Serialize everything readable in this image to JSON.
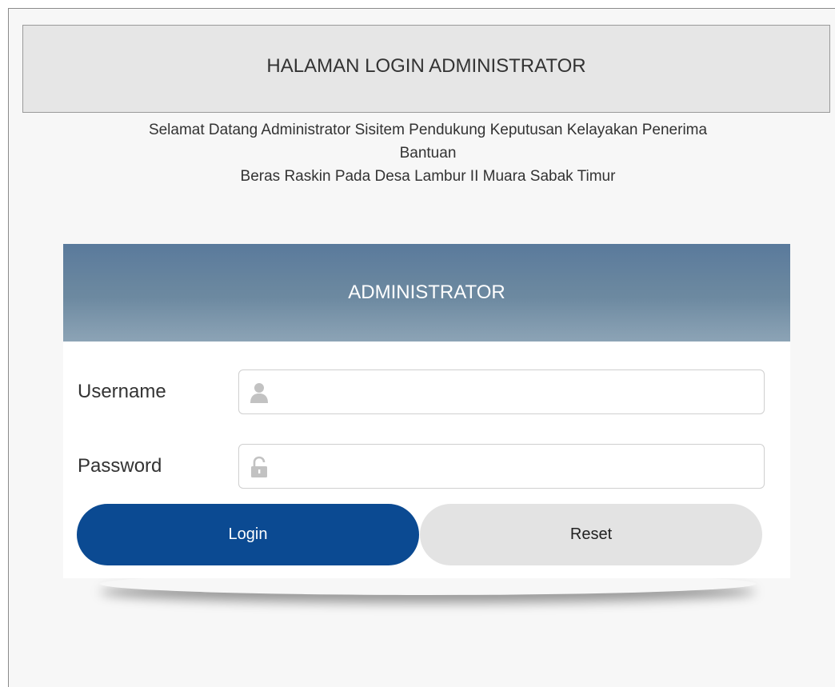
{
  "header": {
    "title": "HALAMAN LOGIN ADMINISTRATOR"
  },
  "welcome": {
    "line1": "Selamat Datang Administrator Sisitem Pendukung Keputusan Kelayakan Penerima",
    "line2": "Bantuan",
    "line3": "Beras Raskin Pada Desa Lambur II Muara Sabak Timur"
  },
  "panel": {
    "title": "ADMINISTRATOR"
  },
  "form": {
    "username_label": "Username",
    "username_value": "",
    "username_icon": "user-icon",
    "password_label": "Password",
    "password_value": "",
    "password_icon": "lock-icon"
  },
  "buttons": {
    "login_label": "Login",
    "reset_label": "Reset"
  },
  "colors": {
    "login_button": "#0b4a92",
    "reset_button": "#e3e3e3",
    "panel_header": "#6a879f",
    "header_box": "#e6e6e6"
  }
}
